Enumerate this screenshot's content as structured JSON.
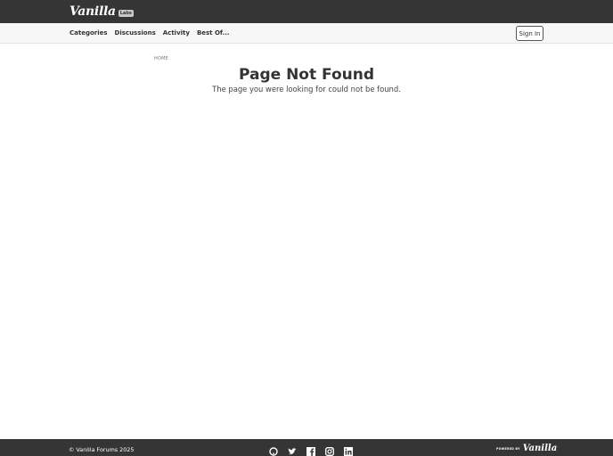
{
  "header": {
    "logo_text": "Vanilla",
    "logo_badge": "Labs"
  },
  "nav": {
    "items": [
      "Categories",
      "Discussions",
      "Activity",
      "Best Of..."
    ],
    "sign_in_label": "Sign In"
  },
  "breadcrumb": {
    "home": "HOME"
  },
  "main": {
    "title": "Page Not Found",
    "message": "The page you were looking for could not be found."
  },
  "footer": {
    "copyright": "© Vanilla Forums 2025",
    "powered_by": "POWERED BY",
    "powered_logo": "Vanilla",
    "social_icons": [
      "github-icon",
      "twitter-icon",
      "facebook-icon",
      "instagram-icon",
      "linkedin-icon"
    ]
  },
  "colors": {
    "header_bg": "#353535",
    "nav_bg": "#f7f7f7",
    "text": "#333333"
  }
}
